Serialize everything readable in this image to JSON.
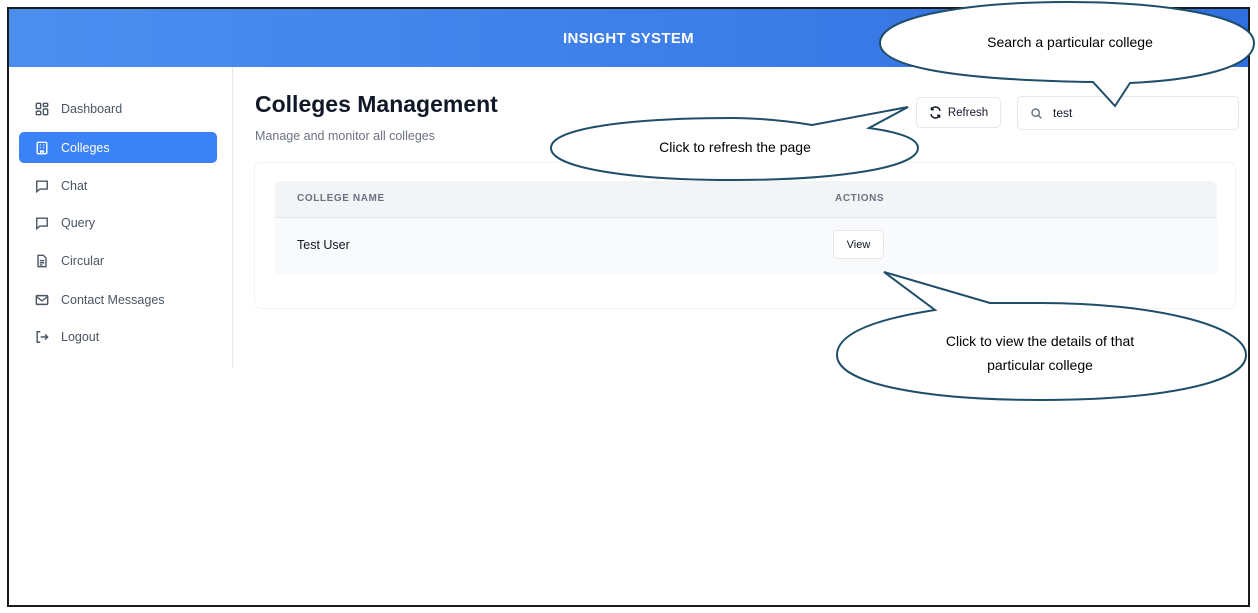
{
  "header": {
    "title": "INSIGHT SYSTEM"
  },
  "sidebar": {
    "items": [
      {
        "label": "Dashboard",
        "icon": "dashboard-icon",
        "active": false
      },
      {
        "label": "Colleges",
        "icon": "building-icon",
        "active": true
      },
      {
        "label": "Chat",
        "icon": "chat-icon",
        "active": false
      },
      {
        "label": "Query",
        "icon": "query-icon",
        "active": false
      },
      {
        "label": "Circular",
        "icon": "document-icon",
        "active": false
      },
      {
        "label": "Contact Messages",
        "icon": "mail-icon",
        "active": false
      },
      {
        "label": "Logout",
        "icon": "logout-icon",
        "active": false
      }
    ]
  },
  "main": {
    "title": "Colleges Management",
    "subtitle": "Manage and monitor all colleges",
    "refresh_label": "Refresh",
    "search_value": "test",
    "table": {
      "columns": [
        "COLLEGE NAME",
        "ACTIONS"
      ],
      "rows": [
        {
          "college_name": "Test User",
          "action_label": "View"
        }
      ]
    }
  },
  "callouts": {
    "search": "Search a particular college",
    "refresh": "Click to refresh the page",
    "view_line1": "Click to view the details of that",
    "view_line2": "particular college"
  },
  "colors": {
    "accent": "#3b82f6",
    "header_gradient_start": "#4a8ff0",
    "header_gradient_end": "#2f6fe0",
    "callout_stroke": "#1f4e6b"
  }
}
